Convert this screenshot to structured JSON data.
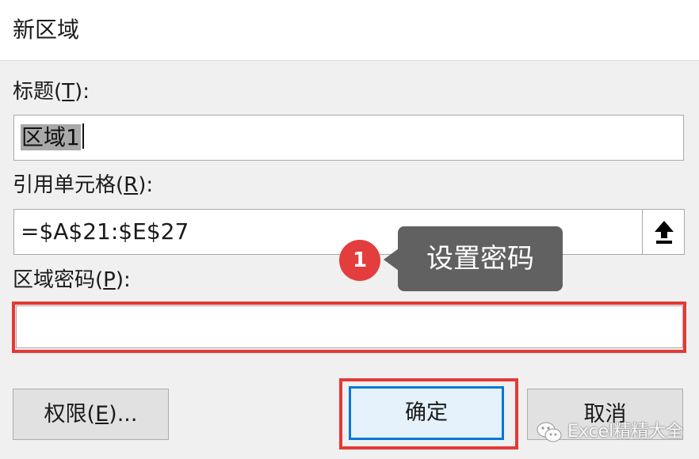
{
  "window": {
    "title": "新区域"
  },
  "fields": {
    "title_label_prefix": "标题(",
    "title_label_key": "T",
    "title_label_suffix": "):",
    "title_value": "区域1",
    "ref_label_prefix": "引用单元格(",
    "ref_label_key": "R",
    "ref_label_suffix": "):",
    "ref_value": "=$A$21:$E$27",
    "password_label_prefix": "区域密码(",
    "password_label_key": "P",
    "password_label_suffix": "):",
    "password_value": ""
  },
  "buttons": {
    "permissions_prefix": "权限(",
    "permissions_key": "E",
    "permissions_suffix": ")...",
    "ok": "确定",
    "cancel": "取消"
  },
  "annotation": {
    "badge_number": "1",
    "tooltip_text": "设置密码",
    "highlight_color": "#e53935"
  },
  "watermark": {
    "text": "Excel精精大全",
    "icon": "wechat-icon"
  },
  "colors": {
    "accent": "#0078d7",
    "badge": "#e33d3d",
    "tooltip_bg": "#616161"
  },
  "icons": {
    "collapse_button": "upload-arrow-icon"
  }
}
